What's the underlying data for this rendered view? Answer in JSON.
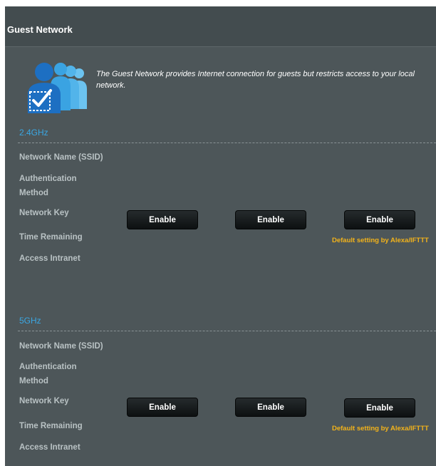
{
  "header": {
    "title": "Guest Network"
  },
  "description": "The Guest Network provides Internet connection for guests but restricts access to your local network.",
  "bands": [
    {
      "title": "2.4GHz",
      "labels": [
        "Network Name (SSID)",
        "Authentication Method",
        "Network Key",
        "Time Remaining",
        "Access Intranet"
      ],
      "buttons": [
        "Enable",
        "Enable",
        "Enable"
      ],
      "default_note": "Default setting by Alexa/IFTTT"
    },
    {
      "title": "5GHz",
      "labels": [
        "Network Name (SSID)",
        "Authentication Method",
        "Network Key",
        "Time Remaining",
        "Access Intranet"
      ],
      "buttons": [
        "Enable",
        "Enable",
        "Enable"
      ],
      "default_note": "Default setting by Alexa/IFTTT"
    }
  ],
  "colors": {
    "panel": "#4d5659",
    "header": "#434c4f",
    "band_title": "#3aa7e3",
    "note": "#f3b31a"
  },
  "icons": {
    "illustration": "guest-users-check-icon"
  }
}
